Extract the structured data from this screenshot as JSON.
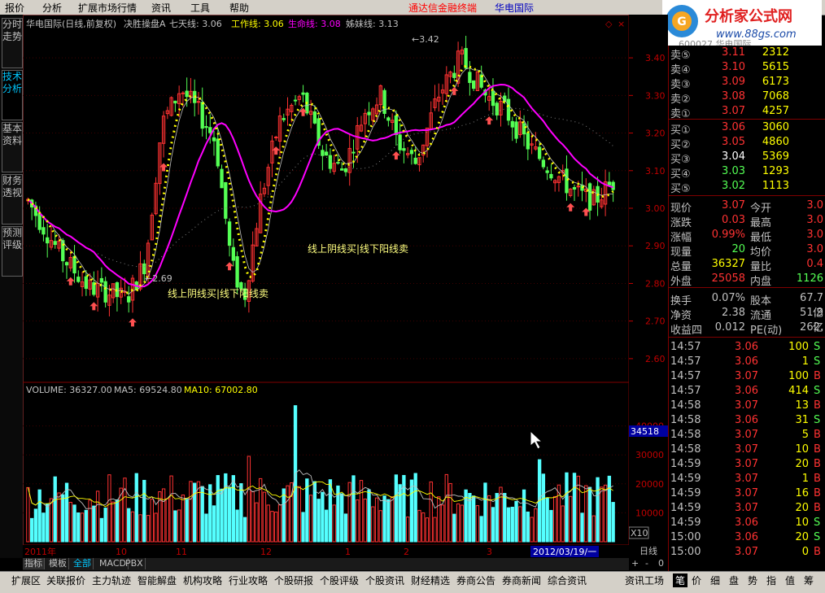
{
  "menu": {
    "items": [
      "报价",
      "分析",
      "扩展市场行情",
      "资讯",
      "工具",
      "帮助"
    ],
    "center_title": "通达信金融终端",
    "center_stock": "华电国际"
  },
  "logo": {
    "text": "分析家公式网",
    "url": "www.88gs.com",
    "sub": "600027 华电国际"
  },
  "left_tabs": [
    "分时走势",
    "技术分析",
    "基本资料",
    "财务透视",
    "预测评级"
  ],
  "chart_header": {
    "title": "华电国际(日线,前复权)",
    "indicator": "决胜操盘A",
    "lines": [
      {
        "name": "七天线",
        "value": "3.06",
        "color": "#c0c0c0"
      },
      {
        "name": "工作线",
        "value": "3.06",
        "color": "#ffff00"
      },
      {
        "name": "生命线",
        "value": "3.08",
        "color": "#ff00ff"
      },
      {
        "name": "姊妹线",
        "value": "3.13",
        "color": "#c0c0c0"
      }
    ]
  },
  "chart_data": [
    {
      "type": "candlestick",
      "title": "华电国际(日线,前复权)",
      "yticks": [
        "3.40",
        "3.30",
        "3.20",
        "3.10",
        "3.00",
        "2.90",
        "2.80",
        "2.70",
        "2.60"
      ],
      "ylim": [
        2.55,
        3.45
      ],
      "annotations": [
        {
          "text": "3.42",
          "kind": "high"
        },
        {
          "text": "2.69",
          "kind": "low"
        },
        {
          "text": "线上阴线买|线下阳线卖"
        },
        {
          "text": "线上阴线买|线下阳线卖"
        }
      ],
      "series": [
        {
          "name": "工作线",
          "color": "#ffff00"
        },
        {
          "name": "生命线",
          "color": "#ff00ff"
        }
      ]
    },
    {
      "type": "bar",
      "title": "VOLUME",
      "header": [
        {
          "name": "VOLUME",
          "value": "36327.00",
          "color": "#c0c0c0"
        },
        {
          "name": "MA5",
          "value": "69524.80",
          "color": "#c0c0c0"
        },
        {
          "name": "MA10",
          "value": "67002.80",
          "color": "#ffff00"
        }
      ],
      "yticks": [
        "40000",
        "30000",
        "20000",
        "10000"
      ],
      "current": "34518",
      "scale_label": "X10",
      "ylim": [
        0,
        50000
      ]
    }
  ],
  "x_axis": {
    "labels": [
      "2011年",
      "10",
      "11",
      "12",
      "1",
      "2",
      "3"
    ],
    "cursor_date": "2012/03/19/一",
    "period": "日线"
  },
  "quote": {
    "asks": [
      [
        "卖⑤",
        "3.11",
        "2312"
      ],
      [
        "卖④",
        "3.10",
        "5615"
      ],
      [
        "卖③",
        "3.09",
        "6173"
      ],
      [
        "卖②",
        "3.08",
        "7068"
      ],
      [
        "卖①",
        "3.07",
        "4257"
      ]
    ],
    "bids": [
      [
        "买①",
        "3.06",
        "3060"
      ],
      [
        "买②",
        "3.05",
        "4860"
      ],
      [
        "买③",
        "3.04",
        "5369"
      ],
      [
        "买④",
        "3.03",
        "1293"
      ],
      [
        "买⑤",
        "3.02",
        "1113"
      ]
    ],
    "stats": [
      [
        "现价",
        "3.07",
        "今开",
        "3.0"
      ],
      [
        "涨跌",
        "0.03",
        "最高",
        "3.0"
      ],
      [
        "涨幅",
        "0.99%",
        "最低",
        "3.0"
      ],
      [
        "现量",
        "20",
        "均价",
        "3.0"
      ],
      [
        "总量",
        "36327",
        "量比",
        "0.4"
      ],
      [
        "外盘",
        "25058",
        "内盘",
        "1126"
      ]
    ],
    "fund": [
      [
        "换手",
        "0.07%",
        "股本",
        "67.7亿"
      ],
      [
        "净资",
        "2.38",
        "流通",
        "51.9亿"
      ],
      [
        "收益四",
        "0.012",
        "PE(动)",
        "262."
      ]
    ],
    "ticks": [
      [
        "14:57",
        "3.06",
        "100",
        "S"
      ],
      [
        "14:57",
        "3.06",
        "1",
        "S"
      ],
      [
        "14:57",
        "3.07",
        "100",
        "B"
      ],
      [
        "14:57",
        "3.06",
        "414",
        "S"
      ],
      [
        "14:58",
        "3.07",
        "13",
        "B"
      ],
      [
        "14:58",
        "3.06",
        "31",
        "S"
      ],
      [
        "14:58",
        "3.07",
        "5",
        "B"
      ],
      [
        "14:58",
        "3.07",
        "10",
        "B"
      ],
      [
        "14:59",
        "3.07",
        "20",
        "B"
      ],
      [
        "14:59",
        "3.07",
        "1",
        "B"
      ],
      [
        "14:59",
        "3.07",
        "16",
        "B"
      ],
      [
        "14:59",
        "3.07",
        "20",
        "B"
      ],
      [
        "14:59",
        "3.06",
        "10",
        "S"
      ],
      [
        "15:00",
        "3.06",
        "20",
        "S"
      ],
      [
        "15:00",
        "3.07",
        "0",
        "B"
      ]
    ]
  },
  "sub_tabs": [
    "指标",
    "模板",
    "全部",
    "MACD",
    "PBX"
  ],
  "status": {
    "items": [
      "扩展区",
      "关联报价",
      "主力轨迹",
      "智能解盘",
      "机构攻略",
      "行业攻略",
      "个股研报",
      "个股评级",
      "个股资讯",
      "财经精选",
      "券商公告",
      "券商新闻",
      "综合资讯",
      "资讯工场"
    ],
    "right": [
      "笔",
      "价",
      "细",
      "盘",
      "势",
      "指",
      "值",
      "筹"
    ]
  },
  "colors": {
    "up": "#ff3232",
    "down": "#54ff54",
    "ma_white": "#c0c0c0",
    "ma_yellow": "#ffff00",
    "life": "#ff00ff",
    "cyan": "#54ffff"
  }
}
